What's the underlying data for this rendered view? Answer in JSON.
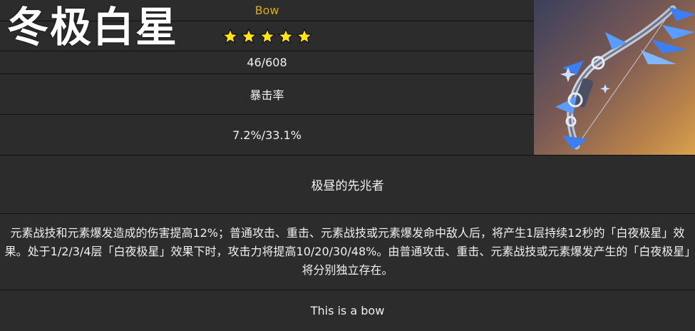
{
  "weapon": {
    "name": "冬极白星",
    "type": "Bow",
    "rarity": 5,
    "base_atk": "46/608",
    "substat_name": "暴击率",
    "substat_value": "7.2%/33.1%",
    "passive_name": "极昼的先兆者",
    "passive_description": "元素战技和元素爆发造成的伤害提高12%；普通攻击、重击、元素战技或元素爆发命中敌人后，将产生1层持续12秒的「白夜极星」效果。处于1/2/3/4层「白夜极星」效果下时，攻击力将提高10/20/30/48%。由普通攻击、重击、元素战技或元素爆发产生的「白夜极星」将分别独立存在。",
    "description": "This is a bow"
  },
  "colors": {
    "background": "#2c2c2c",
    "type_text": "#d9a91a",
    "star_fill": "#ffe41a",
    "star_stroke": "#1a1a1a",
    "divider": "#111111"
  },
  "icons": {
    "star": "star-icon",
    "weapon_art": "bow-art-image"
  }
}
